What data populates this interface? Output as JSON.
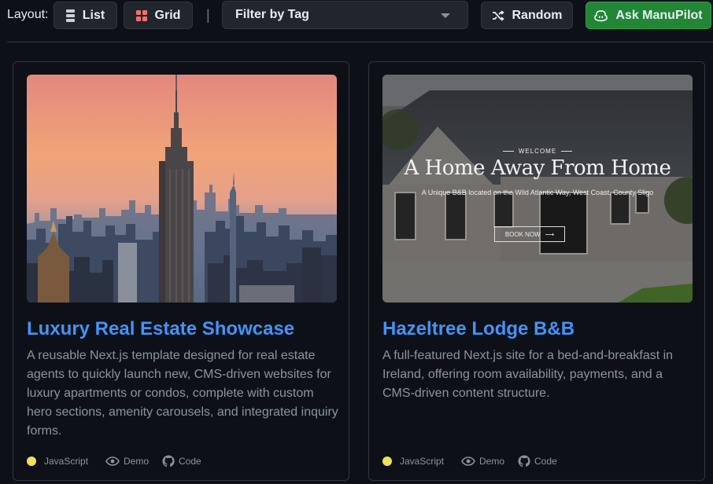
{
  "toolbar": {
    "layout_label": "Layout:",
    "list_label": "List",
    "grid_label": "Grid",
    "separator": "|",
    "filter_label": "Filter by Tag",
    "random_label": "Random",
    "ask_label": "Ask ManuPilot"
  },
  "projects": [
    {
      "title": "Luxury Real Estate Showcase",
      "description": "A reusable Next.js template designed for real estate agents to quickly launch new, CMS-driven websites for luxury apartments or condos, complete with custom hero sections, amenity carousels, and integrated inquiry forms.",
      "language": "JavaScript",
      "demo_label": "Demo",
      "code_label": "Code"
    },
    {
      "title": "Hazeltree Lodge B&B",
      "description": "A full-featured Next.js site for a bed-and-breakfast in Ireland, offering room availability, payments, and a CMS-driven content structure.",
      "language": "JavaScript",
      "demo_label": "Demo",
      "code_label": "Code",
      "thumb": {
        "welcome": "WELCOME",
        "headline": "A Home Away From Home",
        "subline": "A Unique B&B located on the Wild Atlantic Way, West Coast, County Sligo",
        "cta": "BOOK NOW"
      }
    }
  ],
  "colors": {
    "accent": "#4493f8",
    "ask_button": "#238636",
    "javascript_dot": "#f1e05a"
  }
}
